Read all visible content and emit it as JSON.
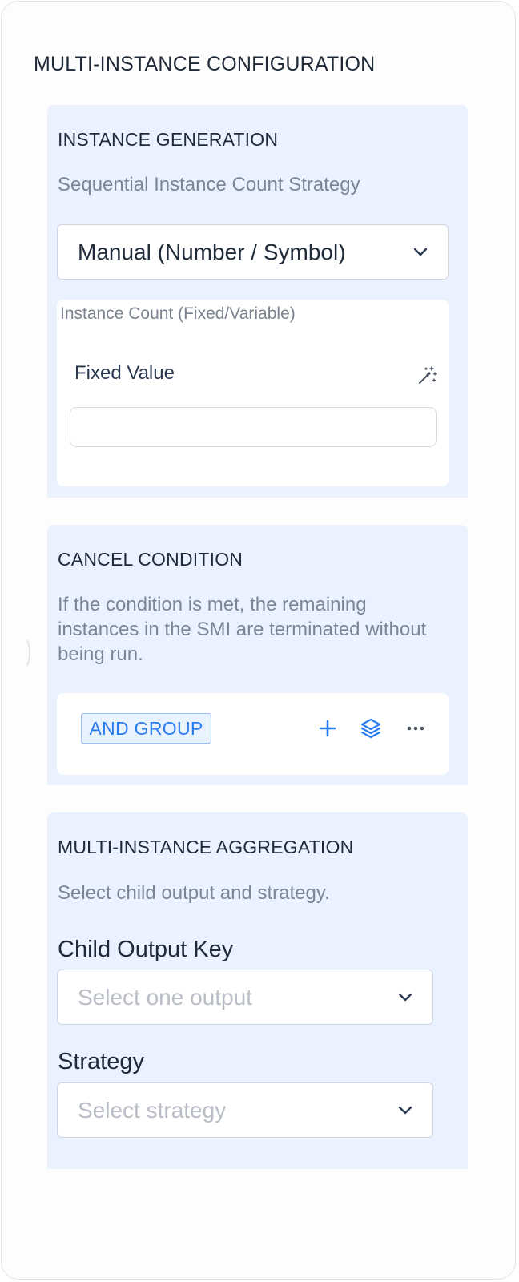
{
  "page": {
    "title": "MULTI-INSTANCE CONFIGURATION"
  },
  "instance_generation": {
    "title": "INSTANCE GENERATION",
    "description": "Sequential Instance Count Strategy",
    "mode_select": {
      "value": "Manual (Number / Symbol)",
      "icon": "chevron-down-icon"
    },
    "instance_count": {
      "label": "Instance Count (Fixed/Variable)",
      "field_label": "Fixed Value",
      "magic_icon": "magic-wand-icon",
      "value": ""
    }
  },
  "cancel_condition": {
    "title": "CANCEL CONDITION",
    "description": "If the condition is met, the remaining instances in the SMI are terminated without being run.",
    "group_label": "AND GROUP",
    "icons": [
      "plus-icon",
      "layers-icon",
      "more-icon"
    ]
  },
  "aggregation": {
    "title": "MULTI-INSTANCE AGGREGATION",
    "description": "Select child output and strategy.",
    "child_output": {
      "label": "Child Output Key",
      "placeholder": "Select one output"
    },
    "strategy": {
      "label": "Strategy",
      "placeholder": "Select strategy"
    }
  },
  "colors": {
    "section_bg": "#eaf2ff",
    "accent": "#2b7cf0",
    "text_dark": "#1f2937",
    "text_muted": "#7b8694"
  }
}
